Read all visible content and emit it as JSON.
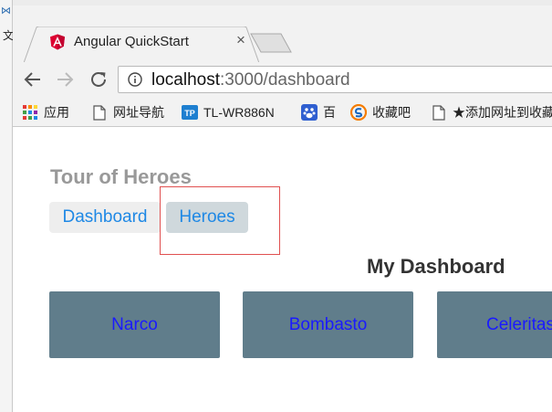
{
  "background_window": {
    "partial_text": "文"
  },
  "browser": {
    "tabs": [
      {
        "title": "Angular QuickStart",
        "favicon": "angular-shield-icon",
        "active": true
      }
    ],
    "address_bar": {
      "host": "localhost",
      "path": ":3000/dashboard"
    },
    "bookmarks": [
      {
        "label": "应用",
        "icon": "apps-grid-icon"
      },
      {
        "label": "网址导航",
        "icon": "page-icon"
      },
      {
        "label": "TL-WR886N",
        "icon": "tp-link-icon"
      },
      {
        "label": "百",
        "icon": "baidu-paw-icon"
      },
      {
        "label": "收藏吧",
        "icon": "sogou-icon"
      },
      {
        "label": "★添加网址到收藏",
        "icon": "page-icon"
      }
    ]
  },
  "app": {
    "title": "Tour of Heroes",
    "nav": [
      {
        "label": "Dashboard"
      },
      {
        "label": "Heroes"
      }
    ],
    "section_title": "My Dashboard",
    "heroes": [
      {
        "name": "Narco"
      },
      {
        "name": "Bombasto"
      },
      {
        "name": "Celeritas"
      }
    ]
  },
  "colors": {
    "accent": "#1e88e5",
    "hero_card": "#607d8b",
    "hero_text": "#1a1aff",
    "angular_red": "#dd0031",
    "highlight_border": "#e05050"
  }
}
